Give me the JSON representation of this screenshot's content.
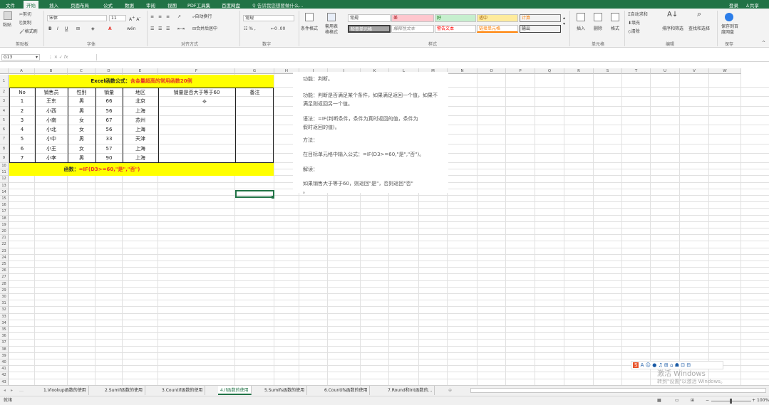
{
  "menu": {
    "tabs": [
      "文件",
      "开始",
      "插入",
      "页面布局",
      "公式",
      "数据",
      "审阅",
      "视图",
      "PDF工具集",
      "百度网盘"
    ],
    "tell_me": "告诉我您想要做什么...",
    "signin": "登录",
    "share": "共享"
  },
  "ribbon": {
    "clipboard": {
      "cut": "剪切",
      "copy": "复制",
      "format_painter": "格式刷",
      "paste": "粘贴",
      "label": "剪贴板"
    },
    "font": {
      "name": "宋体",
      "size": "11",
      "label": "字体"
    },
    "alignment": {
      "wrap": "自动换行",
      "merge": "合并后居中",
      "label": "对齐方式"
    },
    "number": {
      "format": "常规",
      "label": "数字"
    },
    "styles": {
      "cond_format": "条件格式",
      "table_format": "套用表格格式",
      "items": [
        "常规",
        "差",
        "好",
        "适中",
        "计算",
        "检查单元格",
        "解释性文本",
        "警告文本",
        "链接单元格",
        "输出"
      ],
      "label": "样式"
    },
    "cells": {
      "insert": "插入",
      "delete": "删除",
      "format": "格式",
      "label": "单元格"
    },
    "editing": {
      "autosum": "自动求和",
      "fill": "填充",
      "clear": "清除",
      "sort": "排序和筛选",
      "find": "查找和选择",
      "label": "编辑"
    },
    "save": {
      "label": "保存到百度网盘",
      "group": "保存"
    }
  },
  "formula_bar": {
    "name_box": "G13",
    "value": ""
  },
  "columns": [
    "A",
    "B",
    "C",
    "D",
    "E",
    "F",
    "G",
    "H",
    "I",
    "J",
    "K",
    "L",
    "M",
    "N",
    "O",
    "P",
    "Q",
    "R",
    "S",
    "T",
    "U",
    "V",
    "W"
  ],
  "rows": [
    "1",
    "2",
    "3",
    "4",
    "5",
    "6",
    "7",
    "8",
    "9",
    "10",
    "11",
    "12",
    "13",
    "14",
    "15",
    "16",
    "17",
    "18",
    "19",
    "20",
    "21",
    "22",
    "23",
    "24",
    "25",
    "26",
    "27",
    "28",
    "29",
    "30",
    "31",
    "32",
    "33",
    "34",
    "35",
    "36",
    "37",
    "38",
    "39",
    "40",
    "41",
    "42",
    "43",
    "44",
    "45"
  ],
  "sheet": {
    "title_a": "Excel函数公式：",
    "title_b": "含金量超高的常用函数20例",
    "headers": [
      "No",
      "销售员",
      "性别",
      "销量",
      "地区",
      "销量是否大于等于60",
      "备注"
    ],
    "data": [
      [
        "1",
        "王东",
        "男",
        "66",
        "北京"
      ],
      [
        "2",
        "小西",
        "男",
        "56",
        "上海"
      ],
      [
        "3",
        "小南",
        "女",
        "67",
        "苏州"
      ],
      [
        "4",
        "小北",
        "女",
        "56",
        "上海"
      ],
      [
        "5",
        "小中",
        "男",
        "33",
        "天津"
      ],
      [
        "6",
        "小王",
        "女",
        "57",
        "上海"
      ],
      [
        "7",
        "小李",
        "男",
        "90",
        "上海"
      ]
    ],
    "footer_a": "函数：",
    "footer_b": "=IF(D3>=60,\"是\",\"否\")"
  },
  "note": [
    "功能：判断。",
    "功能：判断是否满足某个条件，如果满足返回一个值，如果不",
    "满足则返回另一个值。",
    "语法：=IF(判断条件，条件为真时返回的值，条件为",
    "假时返回的值)。",
    "方法：",
    "在目标单元格中输入公式：=IF(D3>=60,\"是\",\"否\")。",
    "解读：",
    "如果销售大于等于60，则返回\"是\"，否则返回\"否\"",
    "。"
  ],
  "sheet_tabs": [
    "1.Vlookup函数的使用",
    "2.Sumif函数的使用",
    "3.Countif函数的使用",
    "4.If函数的使用",
    "5.Sumifs函数的使用",
    "6.Countifs函数的使用",
    "7.Round和Int函数的..."
  ],
  "active_tab": "4.If函数的使用",
  "status": {
    "ready": "就绪",
    "zoom": "100%"
  },
  "watermark": {
    "line1": "激活 Windows",
    "line2": "转到\"设置\"以激活 Windows。"
  },
  "colors": {
    "header_bg": "#ffff00",
    "accent": "#217346",
    "red_text": "#e8342b"
  }
}
